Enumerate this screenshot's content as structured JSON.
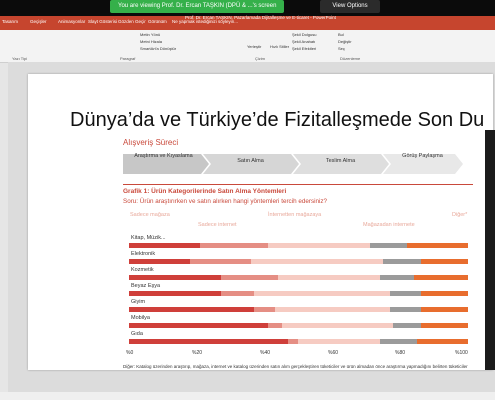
{
  "share_banner": "You are viewing Prof. Dr. Ercan TAŞKIN (DPÜ & ...'s screen",
  "view_options": "View Options",
  "window_subtitle": "Prof. Dr. Ercan TAŞKIN, Pazarlamada Dijitalleşme ve E-ticaret - PowerPoint",
  "ribbon_tabs": [
    "Tasarım",
    "Geçişler",
    "Animasyonlar",
    "Slayt Gösterisi",
    "Gözden Geçir",
    "Görünüm",
    "Ne yapmak istediğinizi söyleyin..."
  ],
  "ribbon_groups": [
    "Yazı Tipi",
    "Paragraf",
    "Çizim",
    "Düzenleme"
  ],
  "ribbon_tools": [
    "Metin Yönü",
    "Metni Hizala",
    "SmartArt'a Dönüştür",
    "Yerleştir",
    "Hızlı Stiller",
    "Şekil Dolgusu",
    "Şekil Anahatı",
    "Şekil Efektleri",
    "Bul",
    "Değiştir",
    "Seç"
  ],
  "slide": {
    "title": "Dünya’da ve Türkiye’de Fizitalleşmede Son Du",
    "section": "Alışveriş Süreci",
    "steps": [
      "Araştırma ve Kıyaslama",
      "Satın Alma",
      "Teslim Alma",
      "Görüş Paylaşma"
    ],
    "graph_title": "Grafik 1: Ürün Kategorilerinde Satın Alma Yöntemleri",
    "question": "Soru: Ürün araştırırken ve satın alırken hangi yöntemleri tercih edersiniz?",
    "legend": [
      "Sadece mağaza",
      "Sadece internet",
      "İnternetten mağazaya",
      "Mağazadan internete",
      "Diğer*"
    ],
    "categories": [
      "Kitap, Müzik...",
      "Elektronik",
      "Kozmetik",
      "Beyaz Eşya",
      "Giyim",
      "Mobilya",
      "Gıda"
    ],
    "axis": [
      "%0",
      "%20",
      "%40",
      "%60",
      "%80",
      "%100"
    ],
    "note": "Diğer: Katalog üzerinden araştırıp, mağaza, internet ve katalog üzerinden satın alım gerçekleştiren tüketiciler ve ürün almadan önce araştırma yapmadığını belirten tüketiciler"
  },
  "colors": {
    "c1": "#cf3f3a",
    "c2": "#e58e84",
    "c3": "#f6cbc2",
    "c4": "#9b9b9b",
    "c5": "#e86d2e"
  },
  "chart_data": {
    "type": "bar",
    "orientation": "horizontal",
    "stacked": true,
    "categories": [
      "Kitap, Müzik...",
      "Elektronik",
      "Kozmetik",
      "Beyaz Eşya",
      "Giyim",
      "Mobilya",
      "Gıda"
    ],
    "series": [
      {
        "name": "Sadece mağaza",
        "values": [
          21,
          18,
          27,
          27,
          37,
          41,
          47
        ]
      },
      {
        "name": "Sadece internet",
        "values": [
          20,
          18,
          17,
          10,
          6,
          4,
          3
        ]
      },
      {
        "name": "İnternetten mağazaya",
        "values": [
          30,
          39,
          30,
          40,
          34,
          33,
          24
        ]
      },
      {
        "name": "Mağazadan internete",
        "values": [
          11,
          11,
          10,
          9,
          9,
          8,
          11
        ]
      },
      {
        "name": "Diğer*",
        "values": [
          18,
          14,
          16,
          14,
          14,
          14,
          15
        ]
      }
    ],
    "xlim": [
      0,
      100
    ]
  }
}
